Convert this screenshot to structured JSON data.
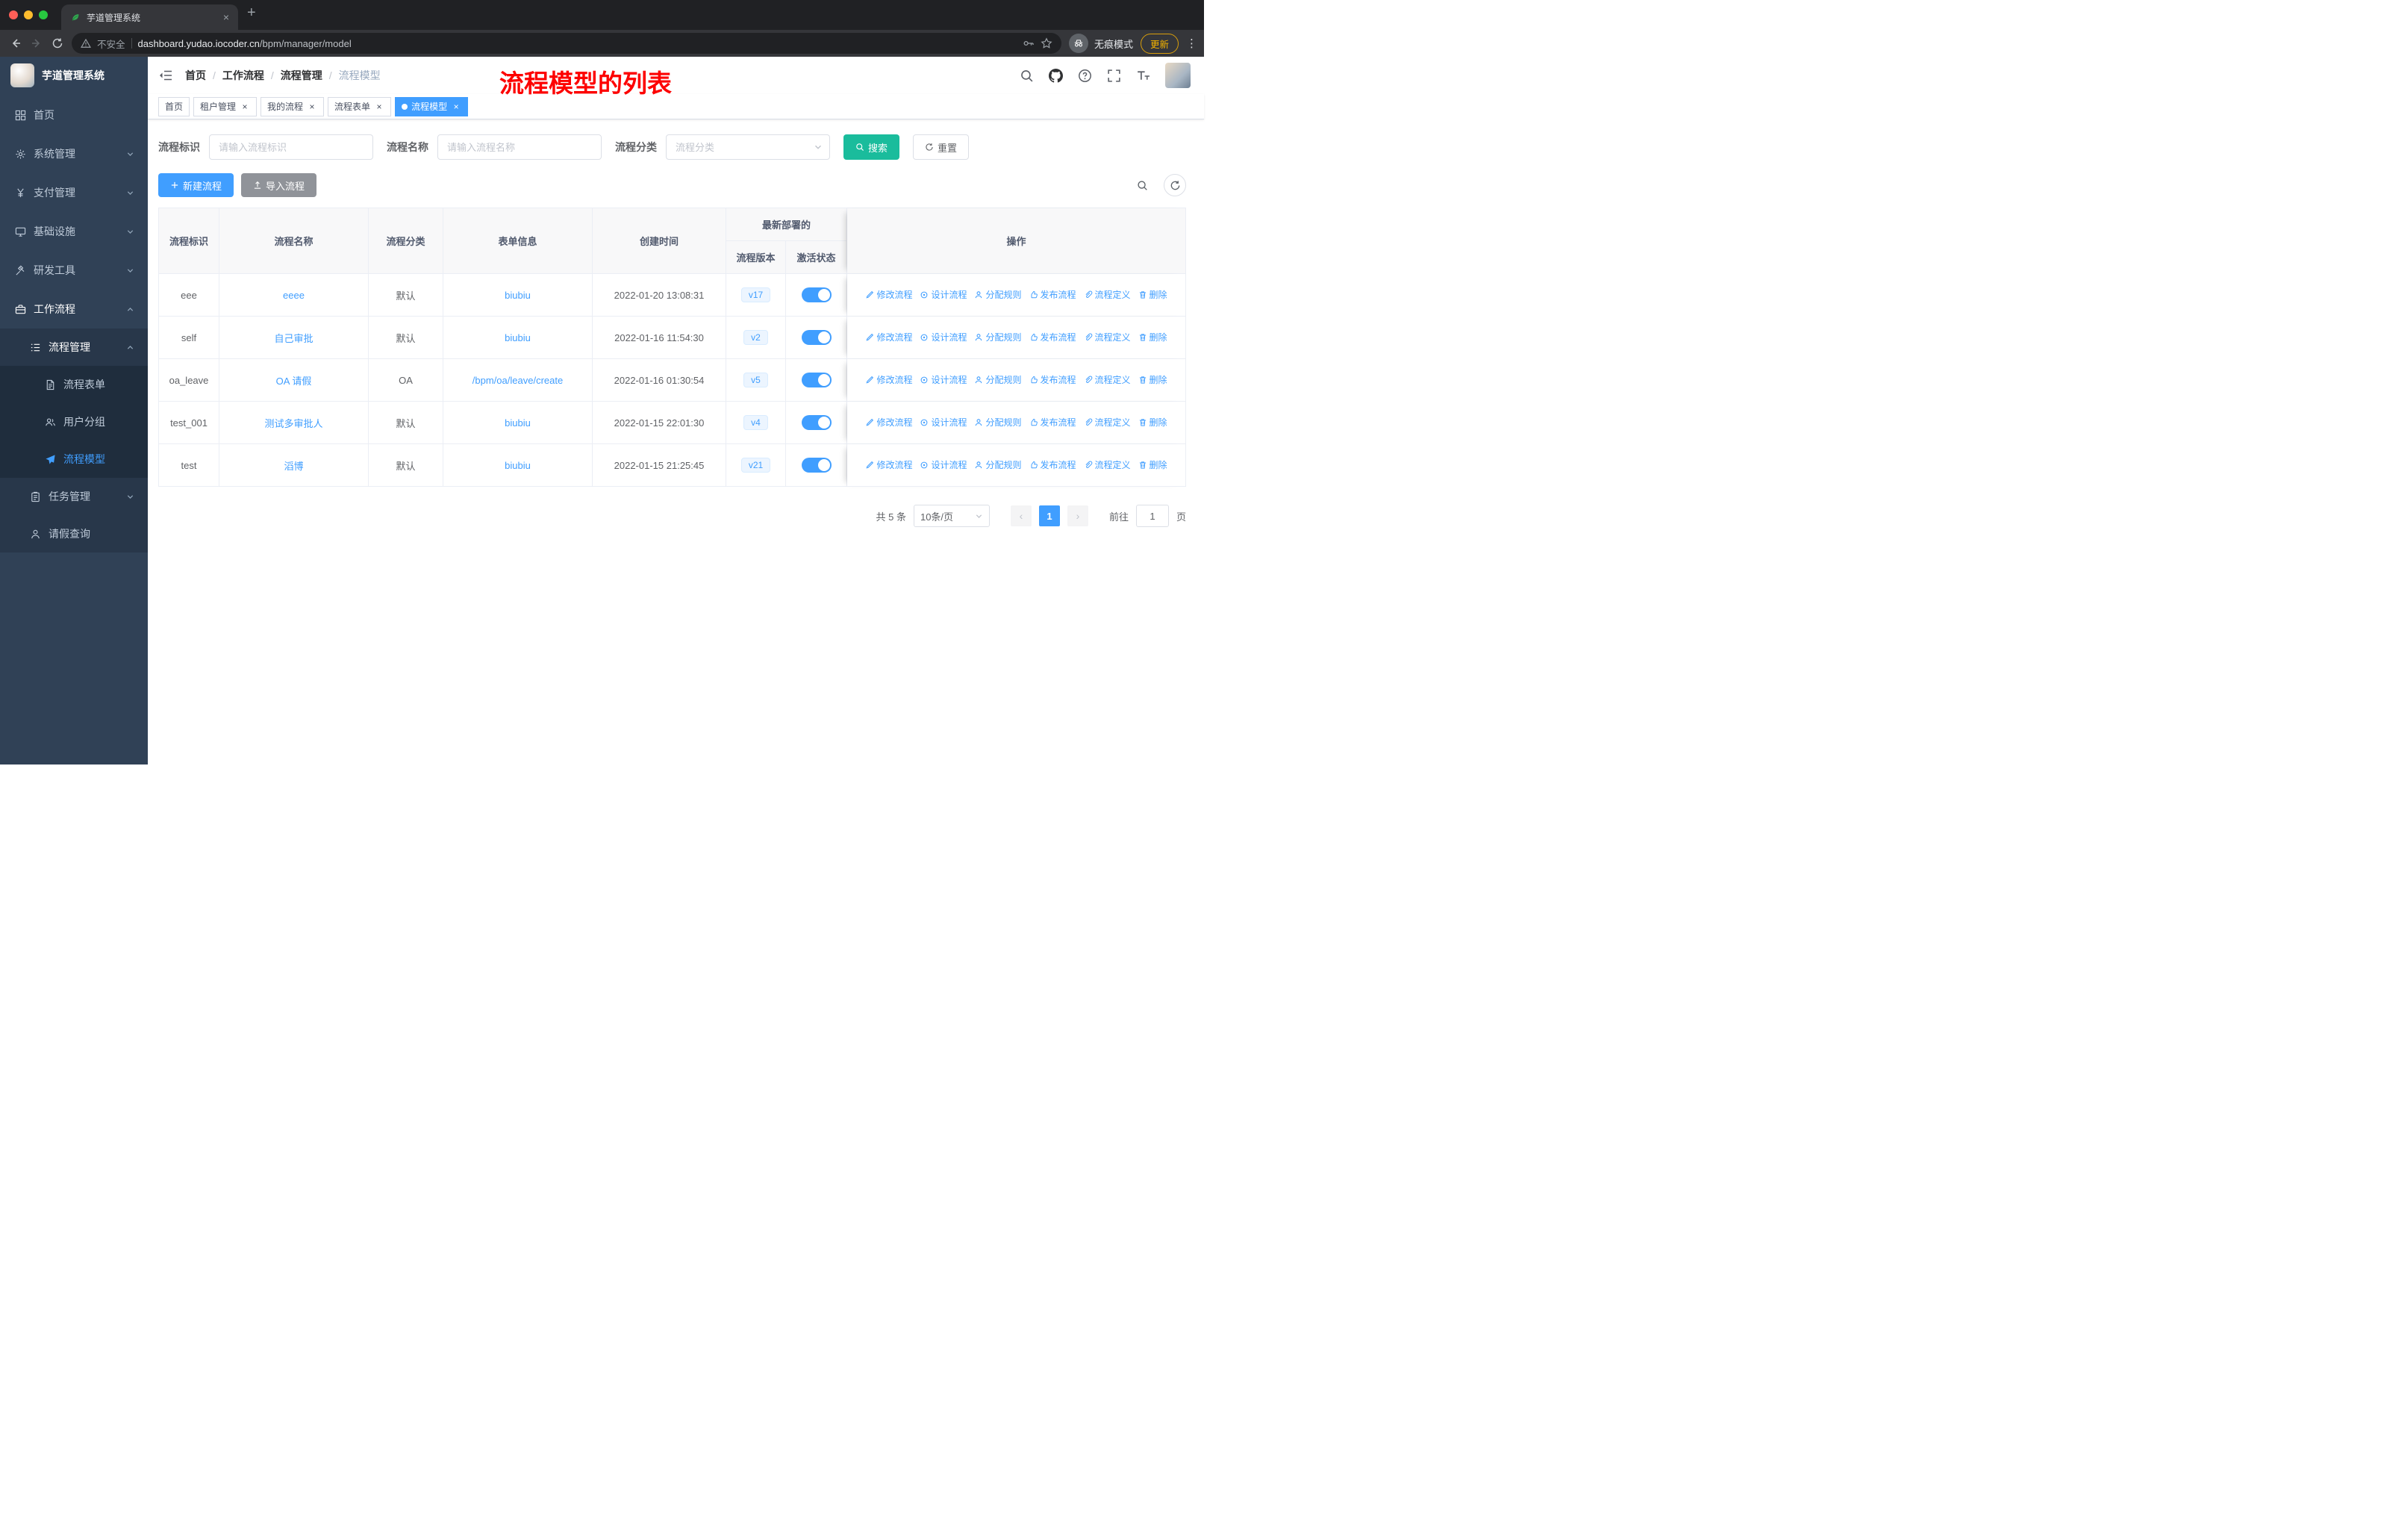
{
  "annotation": "流程模型的列表",
  "browser": {
    "tab_title": "芋道管理系统",
    "security_label": "不安全",
    "url_domain": "dashboard.yudao.iocoder.cn",
    "url_path": "/bpm/manager/model",
    "incognito_label": "无痕模式",
    "update_label": "更新"
  },
  "icons": {
    "close": "×",
    "plus": "+",
    "kebab": "⋮",
    "prev": "‹",
    "next": "›",
    "breadcrumb_separator": "/"
  },
  "sidebar": {
    "title": "芋道管理系统",
    "items": [
      {
        "label": "首页"
      },
      {
        "label": "系统管理"
      },
      {
        "label": "支付管理"
      },
      {
        "label": "基础设施"
      },
      {
        "label": "研发工具"
      },
      {
        "label": "工作流程"
      },
      {
        "label": "流程管理"
      },
      {
        "label": "流程表单"
      },
      {
        "label": "用户分组"
      },
      {
        "label": "流程模型"
      },
      {
        "label": "任务管理"
      },
      {
        "label": "请假查询"
      }
    ]
  },
  "breadcrumb": [
    "首页",
    "工作流程",
    "流程管理",
    "流程模型"
  ],
  "tags": [
    {
      "label": "首页"
    },
    {
      "label": "租户管理"
    },
    {
      "label": "我的流程"
    },
    {
      "label": "流程表单"
    },
    {
      "label": "流程模型"
    }
  ],
  "filters": {
    "id_label": "流程标识",
    "id_placeholder": "请输入流程标识",
    "name_label": "流程名称",
    "name_placeholder": "请输入流程名称",
    "category_label": "流程分类",
    "category_placeholder": "流程分类",
    "search_label": "搜索",
    "reset_label": "重置"
  },
  "toolbar": {
    "create_label": "新建流程",
    "import_label": "导入流程"
  },
  "table": {
    "headers": {
      "id": "流程标识",
      "name": "流程名称",
      "category": "流程分类",
      "form": "表单信息",
      "created": "创建时间",
      "deploy_group": "最新部署的",
      "version": "流程版本",
      "status": "激活状态",
      "actions": "操作"
    },
    "row_actions": [
      {
        "name": "edit-process-link",
        "icon": "edit",
        "label": "修改流程"
      },
      {
        "name": "design-process-link",
        "icon": "design",
        "label": "设计流程"
      },
      {
        "name": "assign-rule-link",
        "icon": "assign",
        "label": "分配规则"
      },
      {
        "name": "publish-process-link",
        "icon": "publish",
        "label": "发布流程"
      },
      {
        "name": "process-definition-link",
        "icon": "definition",
        "label": "流程定义"
      },
      {
        "name": "delete-link",
        "icon": "delete",
        "label": "删除"
      }
    ],
    "rows": [
      {
        "id": "eee",
        "name": "eeee",
        "category": "默认",
        "form": "biubiu",
        "created": "2022-01-20 13:08:31",
        "version": "v17",
        "active": true
      },
      {
        "id": "self",
        "name": "自己审批",
        "category": "默认",
        "form": "biubiu",
        "created": "2022-01-16 11:54:30",
        "version": "v2",
        "active": true
      },
      {
        "id": "oa_leave",
        "name": "OA 请假",
        "category": "OA",
        "form": "/bpm/oa/leave/create",
        "created": "2022-01-16 01:30:54",
        "version": "v5",
        "active": true
      },
      {
        "id": "test_001",
        "name": "测试多审批人",
        "category": "默认",
        "form": "biubiu",
        "created": "2022-01-15 22:01:30",
        "version": "v4",
        "active": true
      },
      {
        "id": "test",
        "name": "滔博",
        "category": "默认",
        "form": "biubiu",
        "created": "2022-01-15 21:25:45",
        "version": "v21",
        "active": true
      }
    ]
  },
  "pagination": {
    "total": "共 5 条",
    "page_size": "10条/页",
    "current_page": "1",
    "goto_label": "前往",
    "goto_value": "1",
    "page_label": "页"
  },
  "colors": {
    "primary": "#409eff",
    "search_button": "#1abc9c",
    "annotation_red": "#fd0100",
    "sidebar_bg": "#304156"
  }
}
